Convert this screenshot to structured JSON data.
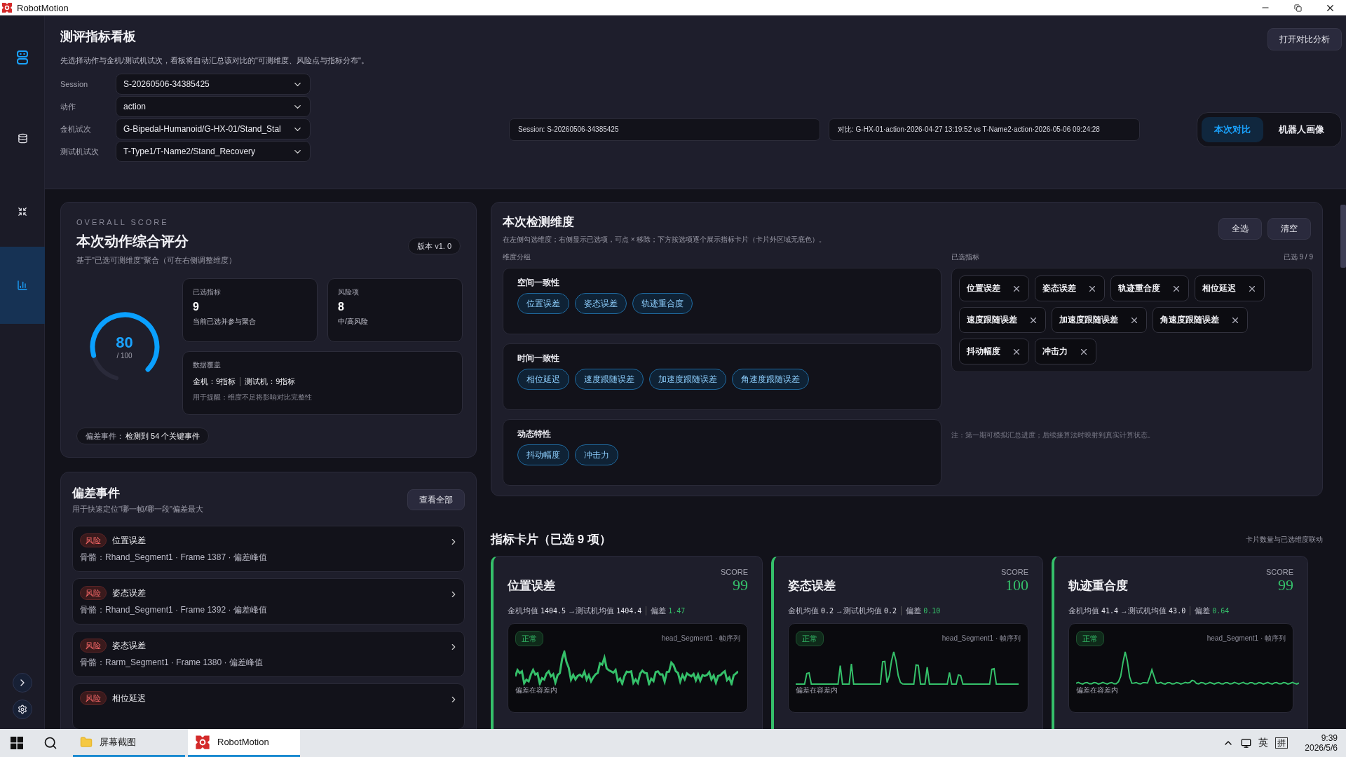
{
  "window": {
    "title": "RobotMotion"
  },
  "sidebar": {
    "items": [
      {
        "kind": "robot",
        "selected": false
      },
      {
        "kind": "database",
        "selected": false
      },
      {
        "kind": "compare",
        "selected": false
      },
      {
        "kind": "chart",
        "selected": true
      }
    ]
  },
  "header": {
    "title": "测评指标看板",
    "description": "先选择动作与金机/测试机试次，看板将自动汇总该对比的\"可测维度、风险点与指标分布\"。",
    "fields": [
      {
        "label": "Session",
        "value": "S-20260506-34385425"
      },
      {
        "label": "动作",
        "value": "action"
      },
      {
        "label": "金机试次",
        "value": "G-Bipedal-Humanoid/G-HX-01/Stand_Stal"
      },
      {
        "label": "测试机试次",
        "value": "T-Type1/T-Name2/Stand_Recovery"
      }
    ],
    "open_compare": "打开对比分析",
    "session_info": "Session: S-20260506-34385425",
    "compare_info": "对比: G-HX-01·action·2026-04-27 13:19:52 vs T-Name2·action·2026-05-06 09:24:28",
    "view_tabs": [
      {
        "label": "本次对比",
        "selected": true
      },
      {
        "label": "机器人画像",
        "selected": false
      }
    ]
  },
  "score": {
    "eyebrow": "OVERALL SCORE",
    "title": "本次动作综合评分",
    "subtitle": "基于\"已选可测维度\"聚合（可在右侧调整维度）",
    "version": "版本 v1. 0",
    "gauge": {
      "value": "80",
      "max": "/ 100",
      "level": 0.8
    },
    "stats": [
      {
        "label": "已选指标",
        "value": "9",
        "note": "当前已选并参与聚合"
      },
      {
        "label": "风险项",
        "value": "8",
        "note": "中/高风险"
      }
    ],
    "coverage": {
      "label": "数据覆盖",
      "golden": "金机：9指标",
      "test": "测试机：9指标",
      "note": "用于提醒：维度不足将影响对比完整性"
    },
    "events_summary": {
      "label": "偏差事件：",
      "text": "检测到 54 个关键事件"
    }
  },
  "dimensions": {
    "title": "本次检测维度",
    "description": "在左侧勾选维度；右侧显示已选项，可点 × 移除；下方按选项逐个展示指标卡片（卡片外区域无底色）。",
    "select_all": "全选",
    "clear": "清空",
    "groups_label": "维度分组",
    "groups": [
      {
        "name": "空间一致性",
        "items": [
          {
            "label": "位置误差",
            "selected": true
          },
          {
            "label": "姿态误差",
            "selected": true
          },
          {
            "label": "轨迹重合度",
            "selected": true
          }
        ]
      },
      {
        "name": "时间一致性",
        "items": [
          {
            "label": "相位延迟",
            "selected": true
          },
          {
            "label": "速度跟随误差",
            "selected": true
          },
          {
            "label": "加速度跟随误差",
            "selected": true
          },
          {
            "label": "角速度跟随误差",
            "selected": true
          }
        ]
      },
      {
        "name": "动态特性",
        "items": [
          {
            "label": "抖动幅度",
            "selected": true
          },
          {
            "label": "冲击力",
            "selected": true
          }
        ]
      }
    ],
    "selected_label": "已选指标",
    "selected_count": "已选 9 / 9",
    "selected": [
      "位置误差",
      "姿态误差",
      "轨迹重合度",
      "相位延迟",
      "速度跟随误差",
      "加速度跟随误差",
      "角速度跟随误差",
      "抖动幅度",
      "冲击力"
    ],
    "note": "注：第一期可模拟汇总进度；后续接算法时映射到真实计算状态。"
  },
  "events": {
    "title": "偏差事件",
    "subtitle": "用于快速定位\"哪一帧/哪一段\"偏差最大",
    "view_all": "查看全部",
    "items": [
      {
        "tag": "风险",
        "name": "位置误差",
        "detail": "骨骼：Rhand_Segment1 · Frame 1387 · 偏差峰值"
      },
      {
        "tag": "风险",
        "name": "姿态误差",
        "detail": "骨骼：Rhand_Segment1 · Frame 1392 · 偏差峰值"
      },
      {
        "tag": "风险",
        "name": "姿态误差",
        "detail": "骨骼：Rarm_Segment1 · Frame 1380 · 偏差峰值"
      },
      {
        "tag": "风险",
        "name": "相位延迟"
      }
    ]
  },
  "cards": {
    "title": "指标卡片（已选 9 项）",
    "note": "卡片数量与已选维度联动",
    "items": [
      {
        "name": "位置误差",
        "score_label": "SCORE",
        "score": "99",
        "golden_label": "金机均值",
        "golden": "1404.5",
        "test_label": "→测试机均值",
        "test": "1404.4",
        "dev_label": "偏差",
        "dev": "1.47",
        "status": "正常",
        "series": "head_Segment1 · 帧序列",
        "footnote": "偏差在容差内"
      },
      {
        "name": "姿态误差",
        "score_label": "SCORE",
        "score": "100",
        "golden_label": "金机均值",
        "golden": "0.2",
        "test_label": "→测试机均值",
        "test": "0.2",
        "dev_label": "偏差",
        "dev": "0.10",
        "status": "正常",
        "series": "head_Segment1 · 帧序列",
        "footnote": "偏差在容差内"
      },
      {
        "name": "轨迹重合度",
        "score_label": "SCORE",
        "score": "99",
        "golden_label": "金机均值",
        "golden": "41.4",
        "test_label": "→测试机均值",
        "test": "43.0",
        "dev_label": "偏差",
        "dev": "0.64",
        "status": "正常",
        "series": "head_Segment1 · 帧序列",
        "footnote": "偏差在容差内"
      }
    ]
  },
  "taskbar": {
    "items": [
      {
        "label": "屏幕截图",
        "kind": "folder",
        "selected": false
      },
      {
        "label": "RobotMotion",
        "kind": "app",
        "selected": true
      }
    ],
    "ime_lang": "英",
    "ime_mode": "拼",
    "time": "9:39",
    "date": "2026/5/6"
  }
}
